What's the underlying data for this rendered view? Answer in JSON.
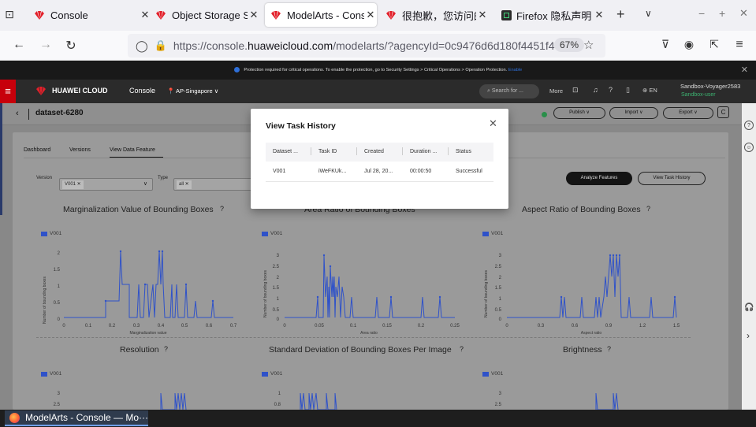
{
  "browser": {
    "tabs": [
      {
        "label": "Console",
        "active": false
      },
      {
        "label": "Object Storage Ser",
        "active": false
      },
      {
        "label": "ModelArts - Conso",
        "active": true
      },
      {
        "label": "很抱歉，您访问的",
        "active": false
      },
      {
        "label": "Firefox 隐私声明 -",
        "active": false
      }
    ],
    "url_prefix": "https://console.",
    "url_host": "huaweicloud.com",
    "url_suffix": "/modelarts/?agencyId=0c9476d6d180f4451f49c0",
    "zoom": "67%"
  },
  "notice": {
    "text": "Protection required for critical operations. To enable the protection, go to Security Settings > Critical Operations > Operation Protection.",
    "enable": "Enable"
  },
  "header": {
    "brand": "HUAWEI CLOUD",
    "console": "Console",
    "region": "AP-Singapore",
    "search_placeholder": "Search for ...",
    "more": "More",
    "lang": "EN",
    "user": "Sandbox-Voyager2583",
    "user_sub": "Sandbox-user"
  },
  "page": {
    "dataset": "dataset-6280",
    "publish": "Publish",
    "import": "Import",
    "export": "Export",
    "tabs": [
      "Dashboard",
      "Versions",
      "View Data Feature"
    ],
    "version_label": "Version",
    "version_tag": "V001",
    "type_label": "Type",
    "type_tag": "all",
    "analyze_btn": "Analyze Features",
    "history_btn": "View Task History"
  },
  "modal": {
    "title": "View Task History",
    "columns": [
      "Dataset ...",
      "Task ID",
      "Created",
      "Duration ...",
      "Status"
    ],
    "rows": [
      [
        "V001",
        "iWeFKUk...",
        "Jul 28, 20...",
        "00:00:50",
        "Successful"
      ]
    ]
  },
  "charts": {
    "c1": {
      "title": "Marginalization Value of Bounding Boxes",
      "legend": "V001",
      "ylabel": "Number of bounding boxes",
      "xlabel": "Marginalization value",
      "xticks": [
        "0",
        "0.1",
        "0.2",
        "0.3",
        "0.4",
        "0.5",
        "0.6",
        "0.7"
      ],
      "yticks": [
        "0",
        "0.5",
        "1",
        "1.5",
        "2"
      ]
    },
    "c2": {
      "title": "Area Ratio of Bounding Boxes",
      "legend": "V001",
      "ylabel": "Number of bounding boxes",
      "xlabel": "Area ratio",
      "xticks": [
        "0",
        "0.05",
        "0.1",
        "0.15",
        "0.2",
        "0.25"
      ],
      "yticks": [
        "0",
        "0.5",
        "1",
        "1.5",
        "2",
        "2.5",
        "3"
      ]
    },
    "c3": {
      "title": "Aspect Ratio of Bounding Boxes",
      "legend": "V001",
      "ylabel": "Number of bounding boxes",
      "xlabel": "Aspect ratio",
      "xticks": [
        "0",
        "0.3",
        "0.6",
        "0.9",
        "1.2",
        "1.5"
      ],
      "yticks": [
        "0",
        "0.5",
        "1",
        "1.5",
        "2",
        "2.5",
        "3"
      ]
    },
    "c4": {
      "title": "Resolution",
      "legend": "V001"
    },
    "c5": {
      "title": "Standard Deviation of Bounding Boxes Per Image",
      "legend": "V001"
    },
    "c6": {
      "title": "Brightness",
      "legend": "V001"
    }
  },
  "taskbar": {
    "label": "ModelArts - Console — Mo···"
  }
}
